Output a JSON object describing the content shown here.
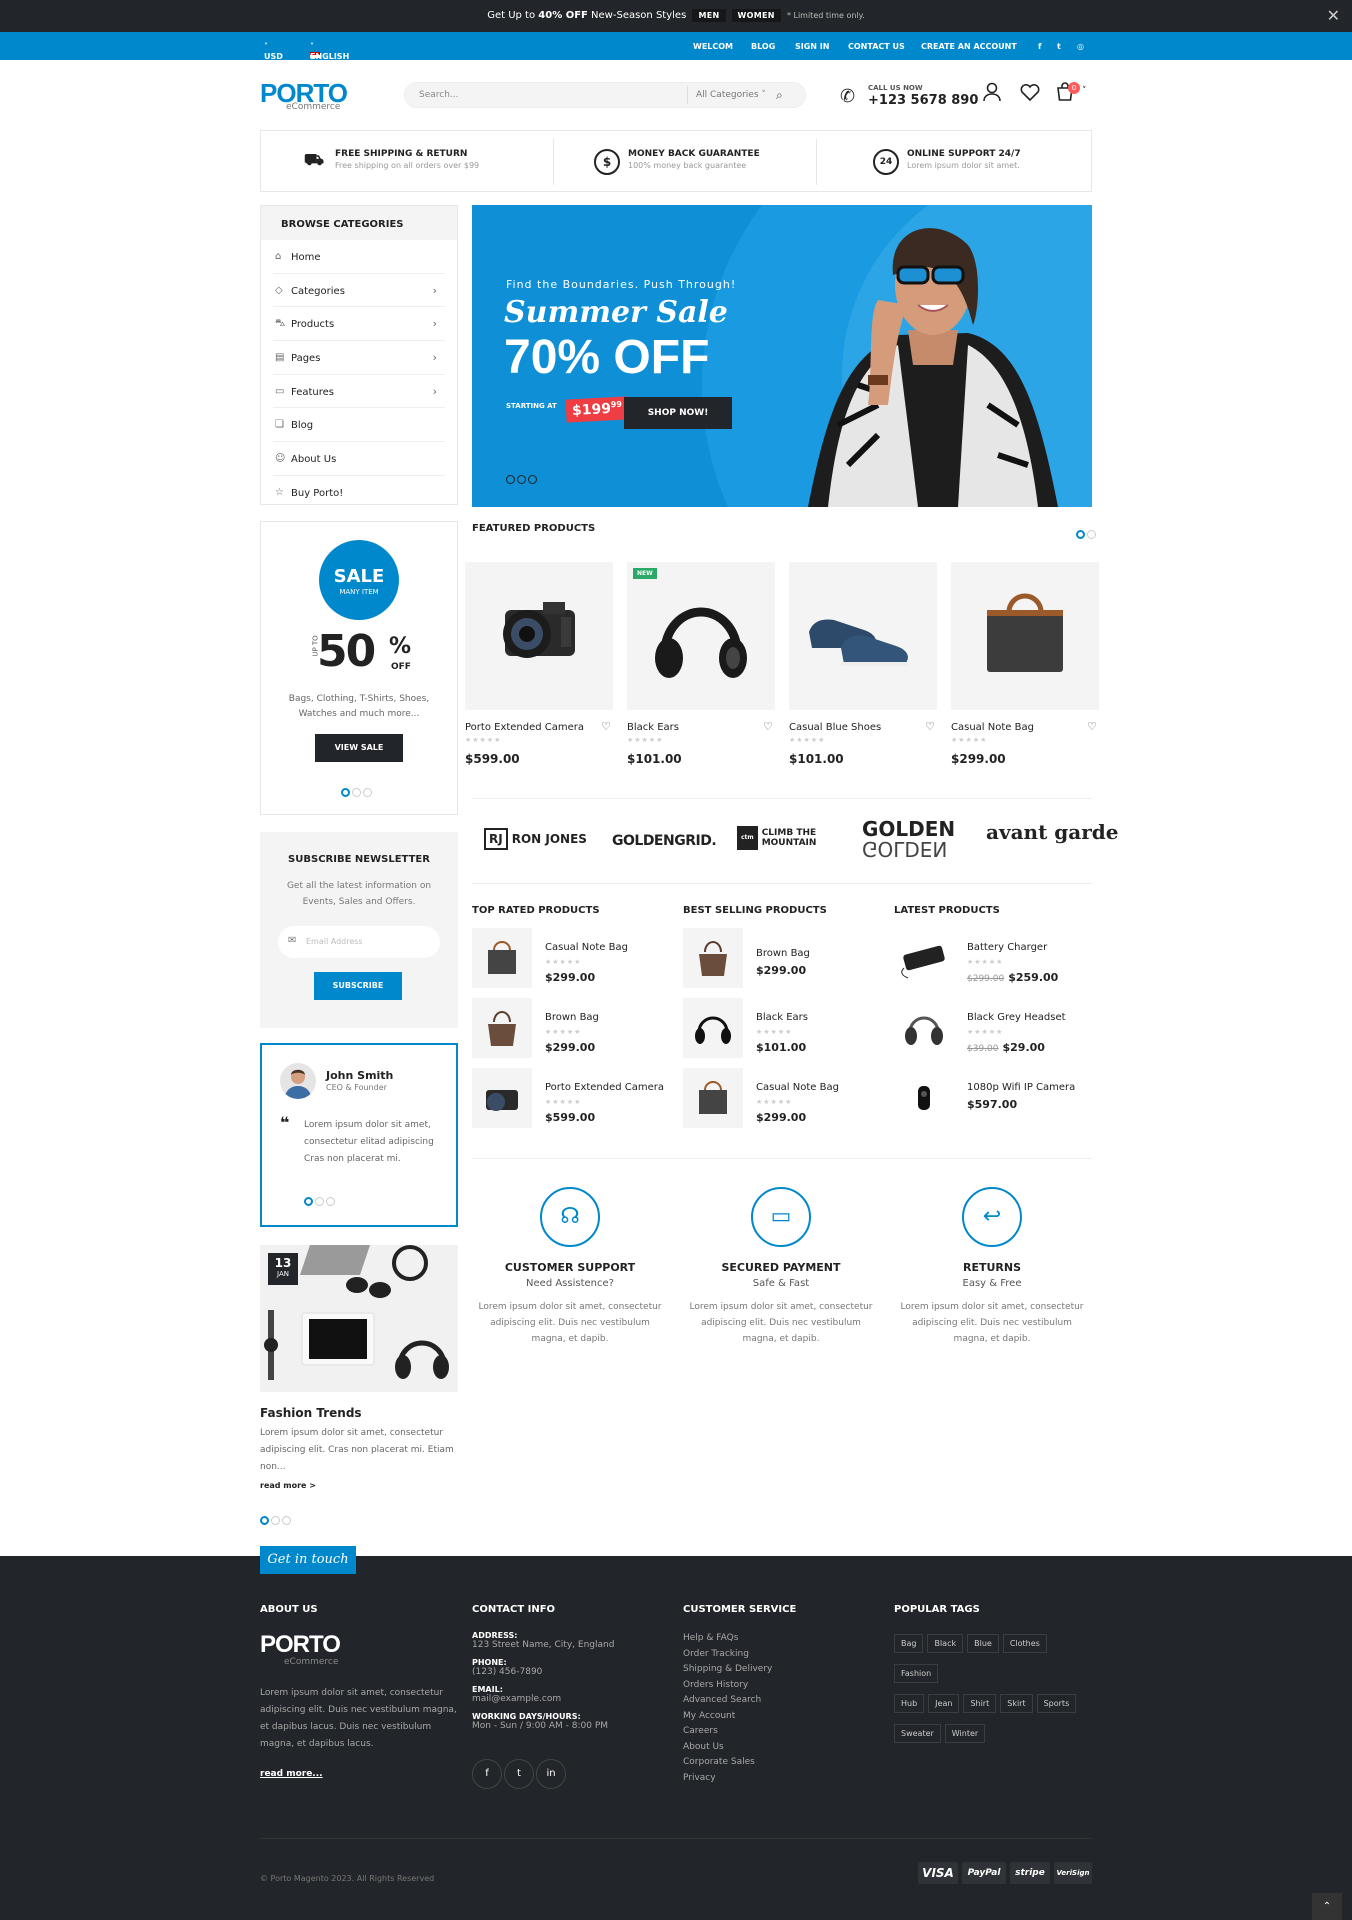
{
  "topbar": {
    "promo_prefix": "Get Up to ",
    "promo_bold": "40% OFF",
    "promo_suffix": " New-Season Styles",
    "chip_men": "MEN",
    "chip_women": "WOMEN",
    "limited": "* Limited time only."
  },
  "navbar": {
    "currency": "USD",
    "language": "ENGLISH",
    "links": [
      "WELCOM",
      "BLOG",
      "SIGN IN",
      "CONTACT US",
      "CREATE AN ACCOUNT"
    ]
  },
  "header": {
    "logo": "PORTO",
    "logo_sub": "eCommerce",
    "search_placeholder": "Search...",
    "search_category": "All Categories",
    "call_label": "CALL US NOW",
    "call_number": "+123 5678 890",
    "cart_count": "0"
  },
  "features": [
    {
      "icon": "truck-icon",
      "title": "FREE SHIPPING & RETURN",
      "sub": "Free shipping on all orders over $99"
    },
    {
      "icon": "dollar-icon",
      "title": "MONEY BACK GUARANTEE",
      "sub": "100% money back guarantee"
    },
    {
      "icon": "support-24-icon",
      "title": "ONLINE SUPPORT 24/7",
      "sub": "Lorem ipsum dolor sit amet."
    }
  ],
  "categories": {
    "title": "BROWSE CATEGORIES",
    "items": [
      {
        "label": "Home",
        "icon": "home-icon",
        "arrow": false
      },
      {
        "label": "Categories",
        "icon": "tag-icon",
        "arrow": true
      },
      {
        "label": "Products",
        "icon": "cart-icon",
        "arrow": true
      },
      {
        "label": "Pages",
        "icon": "pages-icon",
        "arrow": true
      },
      {
        "label": "Features",
        "icon": "features-icon",
        "arrow": true
      },
      {
        "label": "Blog",
        "icon": "blog-icon",
        "arrow": false
      },
      {
        "label": "About Us",
        "icon": "user-icon",
        "arrow": false
      },
      {
        "label": "Buy Porto!",
        "icon": "star-icon",
        "arrow": false
      }
    ]
  },
  "hero": {
    "kicker": "Find the Boundaries. Push Through!",
    "title1": "Summer Sale",
    "title2": "70% OFF",
    "starting": "STARTING AT",
    "price": "$199",
    "price_cents": "99",
    "button": "SHOP NOW!"
  },
  "sale_banner": {
    "sale": "SALE",
    "many": "MANY ITEM",
    "upto": "UP TO",
    "pct": "50",
    "pct_sign": "%",
    "off": "OFF",
    "desc": "Bags, Clothing, T-Shirts, Shoes, Watches and much more...",
    "button": "VIEW SALE"
  },
  "newsletter": {
    "title": "SUBSCRIBE NEWSLETTER",
    "desc": "Get all the latest information on Events, Sales and Offers.",
    "placeholder": "Email Address",
    "button": "SUBSCRIBE"
  },
  "testimonial": {
    "name": "John Smith",
    "role": "CEO & Founder",
    "text": "Lorem ipsum dolor sit amet, consectetur elitad adipiscing Cras non placerat mi."
  },
  "blog": {
    "day": "13",
    "month": "JAN",
    "title": "Fashion Trends",
    "excerpt": "Lorem ipsum dolor sit amet, consectetur adipiscing elit. Cras non placerat mi. Etiam non...",
    "read_more": "read more >"
  },
  "featured": {
    "title": "FEATURED PRODUCTS",
    "products": [
      {
        "name": "Porto Extended Camera",
        "price": "$599.00",
        "new": false,
        "img": "camera"
      },
      {
        "name": "Black Ears",
        "price": "$101.00",
        "new": true,
        "img": "headphones"
      },
      {
        "name": "Casual Blue Shoes",
        "price": "$101.00",
        "new": false,
        "img": "shoes"
      },
      {
        "name": "Casual Note Bag",
        "price": "$299.00",
        "new": false,
        "img": "bag"
      }
    ],
    "new_label": "NEW"
  },
  "brands": [
    {
      "rj": "RJ",
      "text": "RON JONES"
    },
    {
      "text": "GOLDENGRID."
    },
    {
      "ctm": "ctm",
      "text": "CLIMB THE MOUNTAIN"
    },
    {
      "text": "GOLDEN"
    },
    {
      "text": "avant garde"
    }
  ],
  "lists": [
    {
      "title": "TOP RATED PRODUCTS",
      "items": [
        {
          "name": "Casual Note Bag",
          "price": "$299.00",
          "old": ""
        },
        {
          "name": "Brown Bag",
          "price": "$299.00",
          "old": ""
        },
        {
          "name": "Porto Extended Camera",
          "price": "$599.00",
          "old": ""
        }
      ]
    },
    {
      "title": "BEST SELLING PRODUCTS",
      "items": [
        {
          "name": "Brown Bag",
          "price": "$299.00",
          "old": ""
        },
        {
          "name": "Black Ears",
          "price": "$101.00",
          "old": ""
        },
        {
          "name": "Casual Note Bag",
          "price": "$299.00",
          "old": ""
        }
      ]
    },
    {
      "title": "LATEST PRODUCTS",
      "items": [
        {
          "name": "Battery Charger",
          "price": "$259.00",
          "old": "$299.00"
        },
        {
          "name": "Black Grey Headset",
          "price": "$29.00",
          "old": "$39.00"
        },
        {
          "name": "1080p Wifi IP Camera",
          "price": "$597.00",
          "old": ""
        }
      ]
    }
  ],
  "services": [
    {
      "icon": "headset-icon",
      "title": "CUSTOMER SUPPORT",
      "sub": "Need Assistence?",
      "desc": "Lorem ipsum dolor sit amet, consectetur adipiscing elit. Duis nec vestibulum magna, et dapib."
    },
    {
      "icon": "credit-card-icon",
      "title": "SECURED PAYMENT",
      "sub": "Safe & Fast",
      "desc": "Lorem ipsum dolor sit amet, consectetur adipiscing elit. Duis nec vestibulum magna, et dapib."
    },
    {
      "icon": "return-icon",
      "title": "RETURNS",
      "sub": "Easy & Free",
      "desc": "Lorem ipsum dolor sit amet, consectetur adipiscing elit. Duis nec vestibulum magna, et dapib."
    }
  ],
  "footer": {
    "get_in_touch": "Get in touch",
    "about_title": "ABOUT US",
    "logo": "PORTO",
    "logo_sub": "eCommerce",
    "about_text": "Lorem ipsum dolor sit amet, consectetur adipiscing elit. Duis nec vestibulum magna, et dapibus lacus. Duis nec vestibulum magna, et dapibus lacus.",
    "read_more": "read more...",
    "contact_title": "CONTACT INFO",
    "contact": [
      {
        "label": "ADDRESS:",
        "value": "123 Street Name, City, England"
      },
      {
        "label": "PHONE:",
        "value": "(123) 456-7890"
      },
      {
        "label": "EMAIL:",
        "value": "mail@example.com"
      },
      {
        "label": "WORKING DAYS/HOURS:",
        "value": "Mon - Sun / 9:00 AM - 8:00 PM"
      }
    ],
    "service_title": "CUSTOMER SERVICE",
    "service_links": [
      "Help & FAQs",
      "Order Tracking",
      "Shipping & Delivery",
      "Orders History",
      "Advanced Search",
      "My Account",
      "Careers",
      "About Us",
      "Corporate Sales",
      "Privacy"
    ],
    "tags_title": "POPULAR TAGS",
    "tags": [
      "Bag",
      "Black",
      "Blue",
      "Clothes",
      "Fashion",
      "Hub",
      "Jean",
      "Shirt",
      "Skirt",
      "Sports",
      "Sweater",
      "Winter"
    ],
    "copyright": "© Porto Magento 2023. All Rights Reserved",
    "payments": [
      "VISA",
      "PayPal",
      "stripe",
      "VeriSign"
    ]
  }
}
